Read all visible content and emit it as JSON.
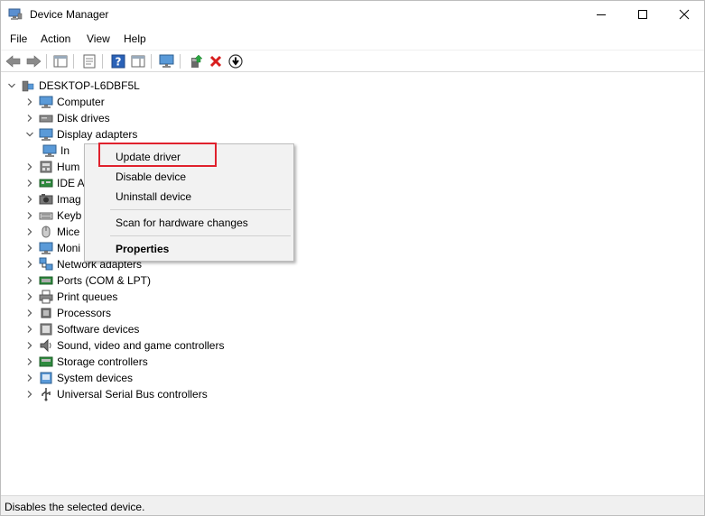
{
  "window": {
    "title": "Device Manager"
  },
  "menubar": {
    "items": [
      "File",
      "Action",
      "View",
      "Help"
    ]
  },
  "tree": {
    "root": "DESKTOP-L6DBF5L",
    "items": [
      {
        "label": "Computer",
        "icon": "computer-icon",
        "expanded": false
      },
      {
        "label": "Disk drives",
        "icon": "disk-drive-icon",
        "expanded": false
      },
      {
        "label": "Display adapters",
        "icon": "display-adapter-icon",
        "expanded": true
      },
      {
        "label": "In",
        "icon": "display-adapter-icon",
        "child": true
      },
      {
        "label": "Hum",
        "icon": "hid-icon",
        "expanded": false
      },
      {
        "label": "IDE A",
        "icon": "ide-icon",
        "expanded": false
      },
      {
        "label": "Imag",
        "icon": "imaging-icon",
        "expanded": false
      },
      {
        "label": "Keyb",
        "icon": "keyboard-icon",
        "expanded": false
      },
      {
        "label": "Mice",
        "icon": "mouse-icon",
        "expanded": false
      },
      {
        "label": "Moni",
        "icon": "monitor-icon",
        "expanded": false
      },
      {
        "label": "Network adapters",
        "icon": "network-icon",
        "expanded": false
      },
      {
        "label": "Ports (COM & LPT)",
        "icon": "port-icon",
        "expanded": false
      },
      {
        "label": "Print queues",
        "icon": "printer-icon",
        "expanded": false
      },
      {
        "label": "Processors",
        "icon": "processor-icon",
        "expanded": false
      },
      {
        "label": "Software devices",
        "icon": "software-device-icon",
        "expanded": false
      },
      {
        "label": "Sound, video and game controllers",
        "icon": "speaker-icon",
        "expanded": false
      },
      {
        "label": "Storage controllers",
        "icon": "storage-icon",
        "expanded": false
      },
      {
        "label": "System devices",
        "icon": "system-device-icon",
        "expanded": false
      },
      {
        "label": "Universal Serial Bus controllers",
        "icon": "usb-icon",
        "expanded": false
      }
    ]
  },
  "context_menu": {
    "items": [
      "Update driver",
      "Disable device",
      "Uninstall device",
      "Scan for hardware changes",
      "Properties"
    ],
    "highlighted": "Update driver"
  },
  "statusbar": {
    "text": "Disables the selected device."
  },
  "colors": {
    "highlight_box": "#e0212d",
    "delete_x": "#d81e1e",
    "help_blue": "#2a62b8"
  }
}
